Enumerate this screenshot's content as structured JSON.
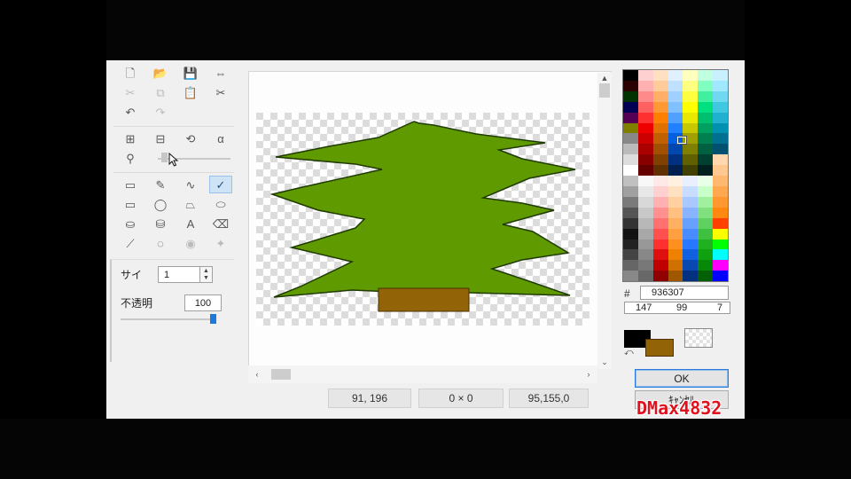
{
  "watermark": "DMax4832",
  "tools": {
    "new": "🗋",
    "open": "📂",
    "save": "💾",
    "resize": "⇔",
    "cut": "✂",
    "copy": "⧉",
    "paste": "📋",
    "crop": "✂",
    "undo": "↶",
    "redo": "↷",
    "flip_h": "⊞",
    "flip_v": "⊟",
    "rotate": "⟲",
    "color_adjust": "α",
    "zoom": "⚲",
    "select_rect": "▭",
    "pipette": "✎",
    "freeform": "∿",
    "pen": "✓",
    "rectangle": "▭",
    "ellipse": "◯",
    "polygon": "⏢",
    "rounded": "⬭",
    "fill": "⛀",
    "replace": "⛁",
    "text": "A",
    "eraser": "⌫",
    "line": "⟋",
    "lasso": "◌",
    "blur": "◉",
    "sharpen": "✦"
  },
  "properties": {
    "size_label": "サイ",
    "size_value": "1",
    "spin_up": "▲",
    "spin_down": "▼",
    "opacity_label": "不透明",
    "opacity_value": "100",
    "opacity_level": 1.0
  },
  "scroll": {
    "up": "▲",
    "down": "⌄",
    "left": "‹",
    "right": "›"
  },
  "status": {
    "cursor_pos": "91, 196",
    "selection_size": "0 × 0",
    "color_value": "95,155,0"
  },
  "color": {
    "hash": "#",
    "hex": "936307",
    "r": "147",
    "g": "99",
    "b": "7",
    "foreground": "#000000",
    "background": "#936307",
    "swap": "⤺"
  },
  "buttons": {
    "ok": "OK",
    "cancel": "ｷｬﾝｾﾙ"
  },
  "image": {
    "tree_color": "#5f9b00",
    "trunk_color": "#936307"
  }
}
